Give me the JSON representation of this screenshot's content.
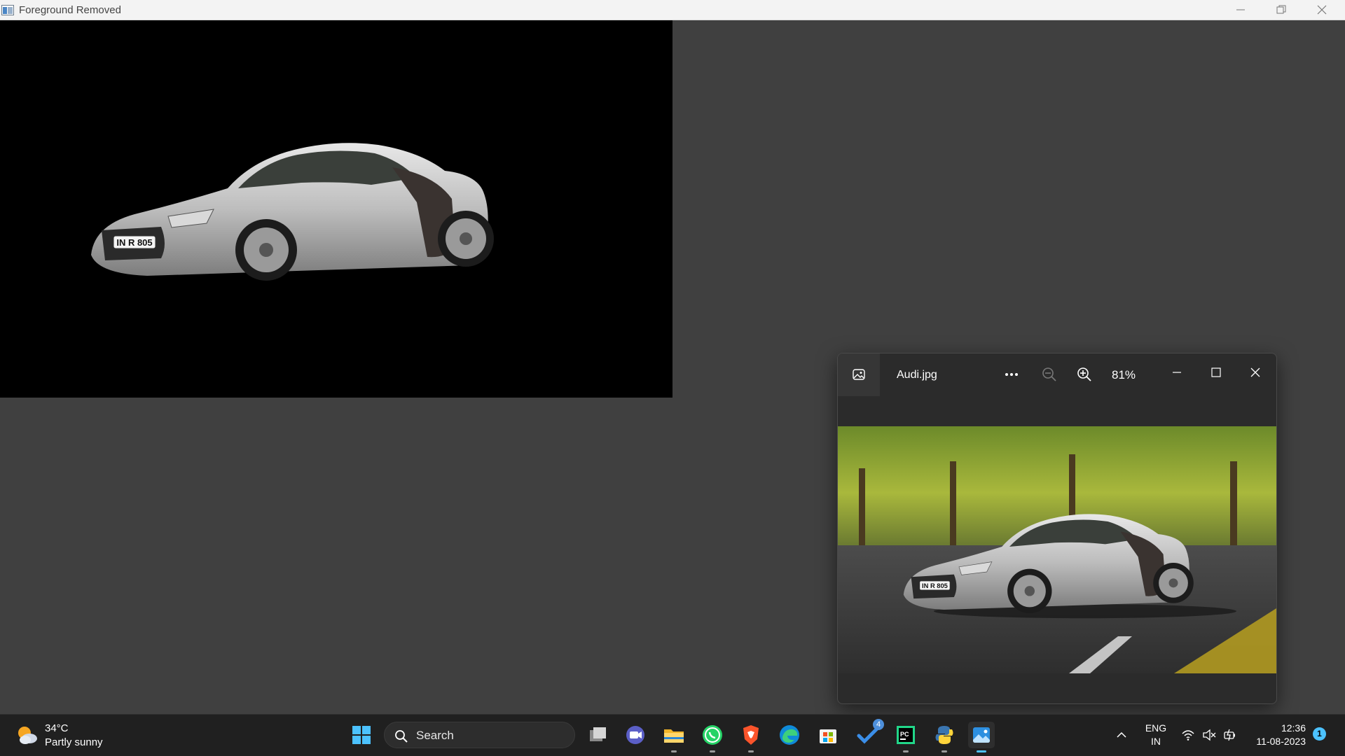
{
  "main_window": {
    "title": "Foreground Removed"
  },
  "photo_viewer": {
    "filename": "Audi.jpg",
    "zoom": "81%"
  },
  "car": {
    "plate": "IN R 805"
  },
  "taskbar": {
    "weather": {
      "temp": "34°C",
      "condition": "Partly sunny"
    },
    "search_label": "Search",
    "pinned_apps": [
      "start",
      "search",
      "task-view",
      "meet",
      "file-explorer",
      "whatsapp",
      "brave",
      "edge",
      "store",
      "todo",
      "pycharm",
      "python",
      "photos"
    ],
    "todo_badge": "4",
    "language": {
      "line1": "ENG",
      "line2": "IN"
    },
    "clock": {
      "time": "12:36",
      "date": "11-08-2023"
    },
    "notification_count": "1"
  },
  "colors": {
    "desktop_bg": "#404040",
    "taskbar_bg": "#202020",
    "accent": "#4cc2ff"
  }
}
